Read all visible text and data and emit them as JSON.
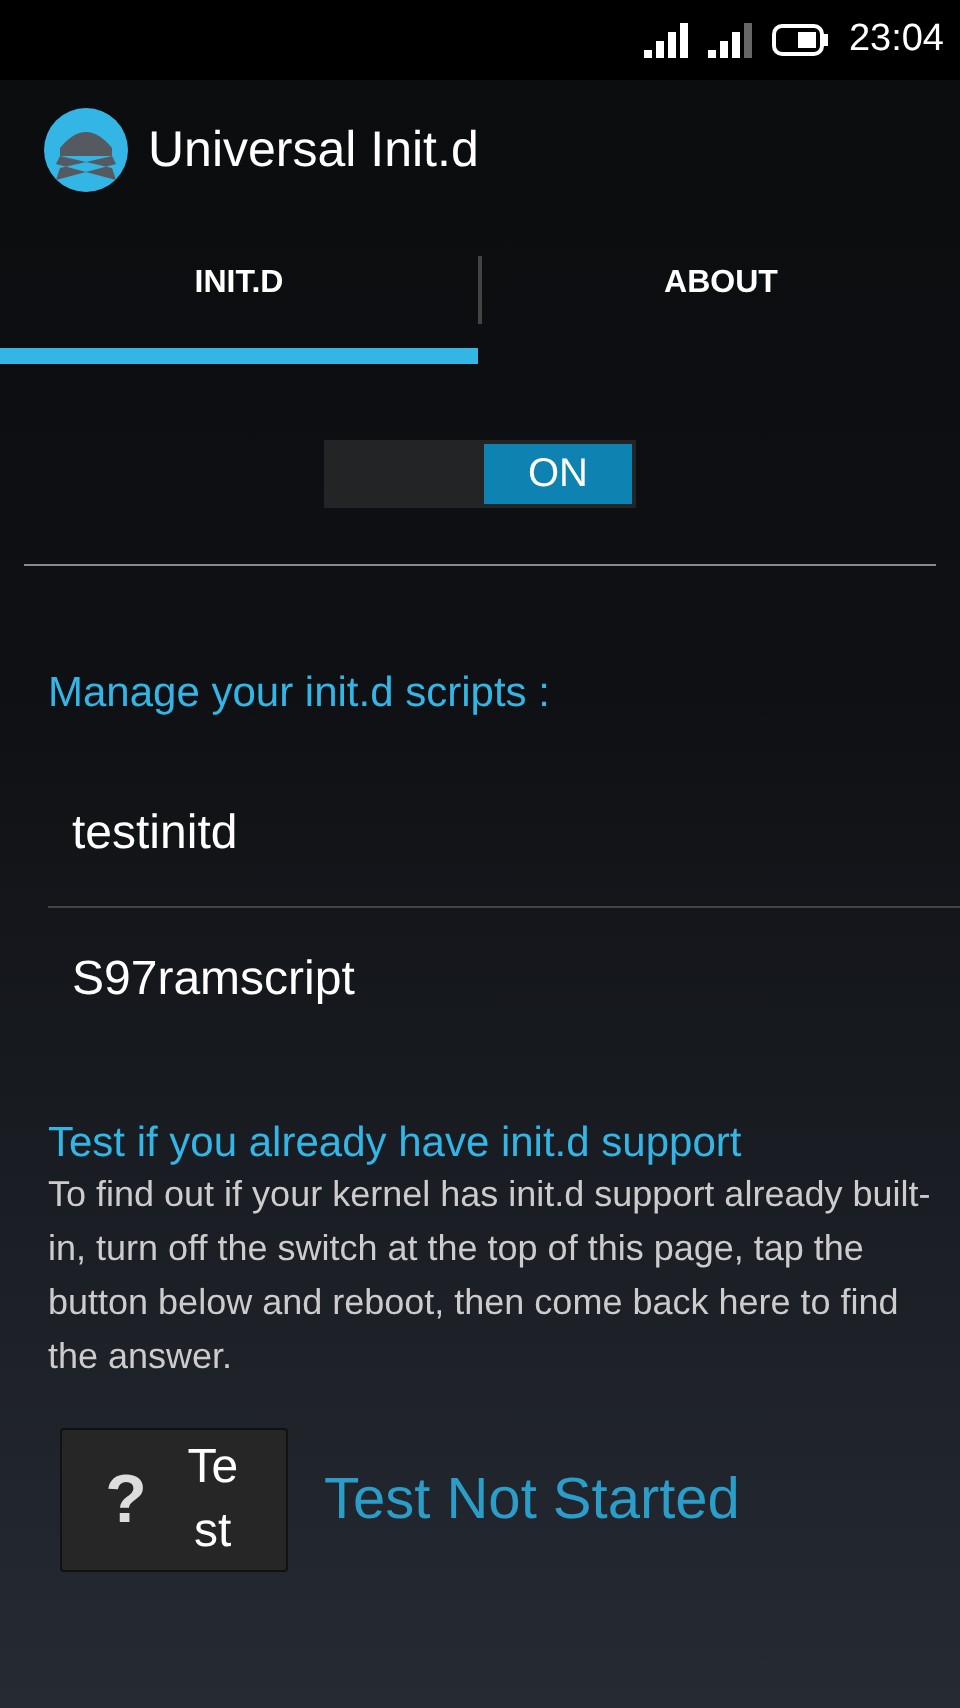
{
  "status_bar": {
    "time": "23:04"
  },
  "action_bar": {
    "title": "Universal Init.d"
  },
  "tabs": [
    {
      "label": "INIT.D",
      "selected": true
    },
    {
      "label": "ABOUT",
      "selected": false
    }
  ],
  "switch": {
    "on": true,
    "label": "ON"
  },
  "scripts_heading": "Manage your init.d scripts :",
  "scripts": [
    "testinitd",
    "S97ramscript"
  ],
  "test": {
    "heading": "Test if you already have init.d support",
    "description": "To find out if your kernel has init.d support already built-in, turn off the switch at the top of this page, tap the button below and reboot, then come back here to find the answer.",
    "button_icon": "?",
    "button_label": "Test",
    "result": "Test Not Started"
  }
}
